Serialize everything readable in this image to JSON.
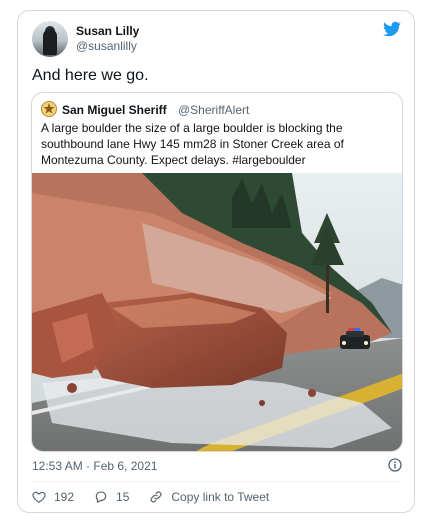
{
  "tweet": {
    "author_name": "Susan Lilly",
    "author_handle": "@susanlilly",
    "text": "And here we go.",
    "timestamp": "12:53 AM · Feb 6, 2021",
    "likes": "192",
    "replies": "15",
    "copy_link_label": "Copy link to Tweet"
  },
  "quoted": {
    "author_name": "San Miguel Sheriff",
    "author_handle": "@SheriffAlert",
    "text": "A large boulder the size of a large boulder is blocking the southbound lane Hwy 145 mm28 in Stoner Creek area of Montezuma County. Expect delays. #largeboulder"
  },
  "colors": {
    "twitter_blue": "#1d9bf0",
    "muted": "#536471",
    "border": "#cfd9de"
  },
  "icons": [
    "twitter-bird-icon",
    "sheriff-badge-icon",
    "info-icon",
    "heart-icon",
    "reply-icon",
    "link-icon"
  ]
}
